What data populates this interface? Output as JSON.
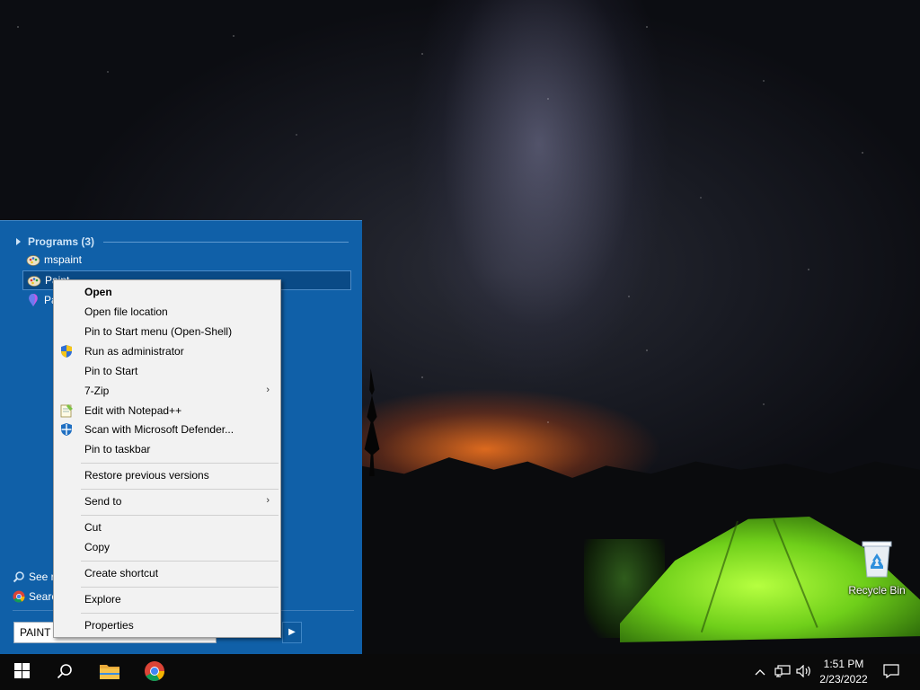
{
  "desktop": {
    "recycle_bin_label": "Recycle Bin"
  },
  "start_menu": {
    "programs_header": "Programs (3)",
    "programs": [
      {
        "label": "mspaint",
        "icon": "paint-icon",
        "selected": false
      },
      {
        "label": "Paint",
        "icon": "paint-icon",
        "selected": true
      },
      {
        "label": "Pa",
        "icon": "paint-3d-icon",
        "selected": false
      }
    ],
    "see_more": "See r",
    "search_web": "Searc",
    "search_value": "PAINT",
    "arrow_icon": "chevron-right-icon"
  },
  "context_menu": {
    "items": [
      {
        "label": "Open",
        "bold": true
      },
      {
        "label": "Open file location"
      },
      {
        "label": "Pin to Start menu (Open-Shell)"
      },
      {
        "label": "Run as administrator",
        "icon": "uac-shield-icon"
      },
      {
        "label": "Pin to Start"
      },
      {
        "label": "7-Zip",
        "submenu": true
      },
      {
        "label": "Edit with Notepad++",
        "icon": "notepad-plus-plus-icon"
      },
      {
        "label": "Scan with Microsoft Defender...",
        "icon": "defender-icon"
      },
      {
        "label": "Pin to taskbar"
      },
      {
        "label": "Restore previous versions"
      },
      {
        "label": "Send to",
        "submenu": true
      },
      {
        "label": "Cut"
      },
      {
        "label": "Copy"
      },
      {
        "label": "Create shortcut"
      },
      {
        "label": "Explore"
      },
      {
        "label": "Properties"
      }
    ],
    "submenu_glyph": "›"
  },
  "taskbar": {
    "clock_time": "1:51 PM",
    "clock_date": "2/23/2022",
    "pinned": [
      "windows-start-icon",
      "search-icon",
      "file-explorer-icon",
      "chrome-icon"
    ],
    "tray": [
      "chevron-up-icon",
      "network-icon",
      "volume-icon",
      "notification-icon"
    ]
  }
}
